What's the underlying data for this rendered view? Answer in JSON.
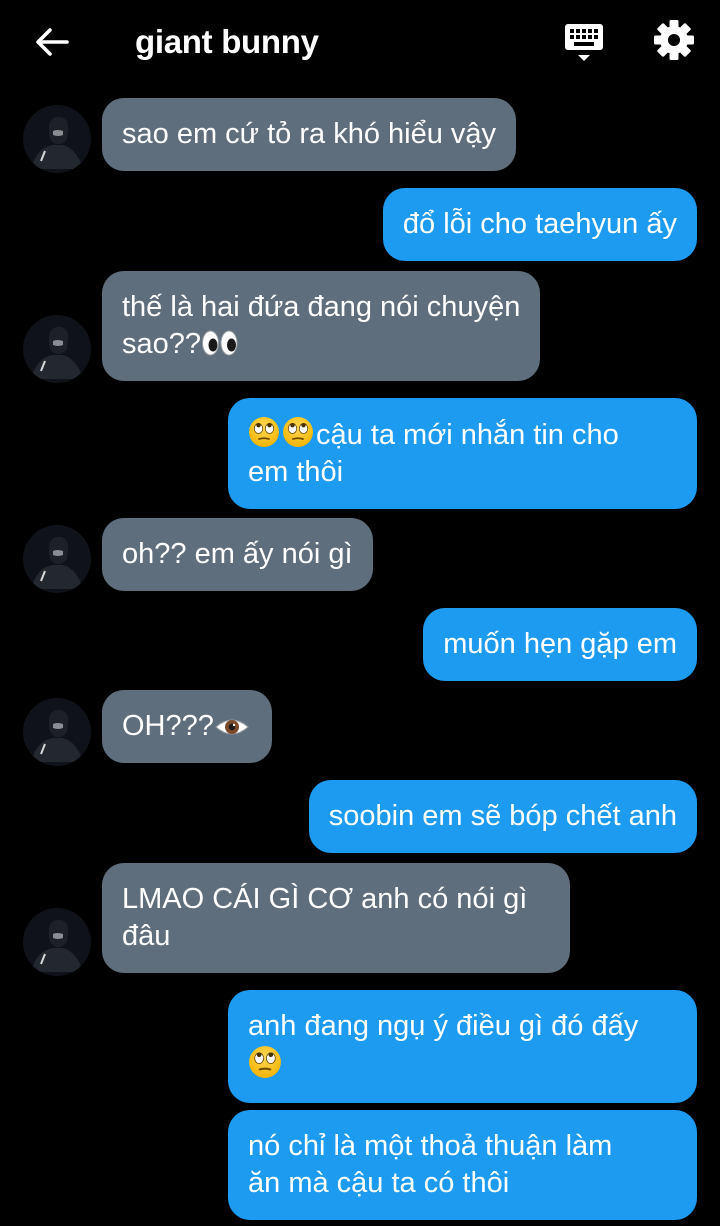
{
  "header": {
    "title": "giant bunny",
    "back_icon": "arrow-left-icon",
    "keyboard_icon": "keyboard-icon",
    "settings_icon": "gear-icon"
  },
  "colors": {
    "background": "#000000",
    "incoming_bubble": "#5f6e7c",
    "outgoing_bubble": "#1d9bf0",
    "text": "#ffffff"
  },
  "messages": [
    {
      "dir": "in",
      "text": "sao em cứ tỏ ra khó hiểu vậy"
    },
    {
      "dir": "out",
      "text": "đổ lỗi cho taehyun ấy"
    },
    {
      "dir": "in",
      "line1": "thế là hai đứa đang nói chuyện",
      "line2": "sao??",
      "emoji": "eyes"
    },
    {
      "dir": "out",
      "emoji": "face-with-rolling-eyes x2",
      "line1": "cậu ta mới nhắn tin cho",
      "line2": "em thôi"
    },
    {
      "dir": "in",
      "text": "oh?? em ấy nói gì"
    },
    {
      "dir": "out",
      "text": "muốn hẹn gặp em"
    },
    {
      "dir": "in",
      "text": "OH???",
      "emoji": "eye"
    },
    {
      "dir": "out",
      "text": "soobin em sẽ bóp chết anh"
    },
    {
      "dir": "in",
      "line1": "LMAO CÁI GÌ CƠ anh có nói gì",
      "line2": "đâu"
    },
    {
      "dir": "out",
      "line1": "anh đang ngụ ý điều gì đó đấy",
      "emoji": "face-with-rolling-eyes"
    },
    {
      "dir": "out",
      "line1": "nó chỉ là một thoả thuận làm",
      "line2": "ăn mà cậu ta có thôi"
    }
  ]
}
